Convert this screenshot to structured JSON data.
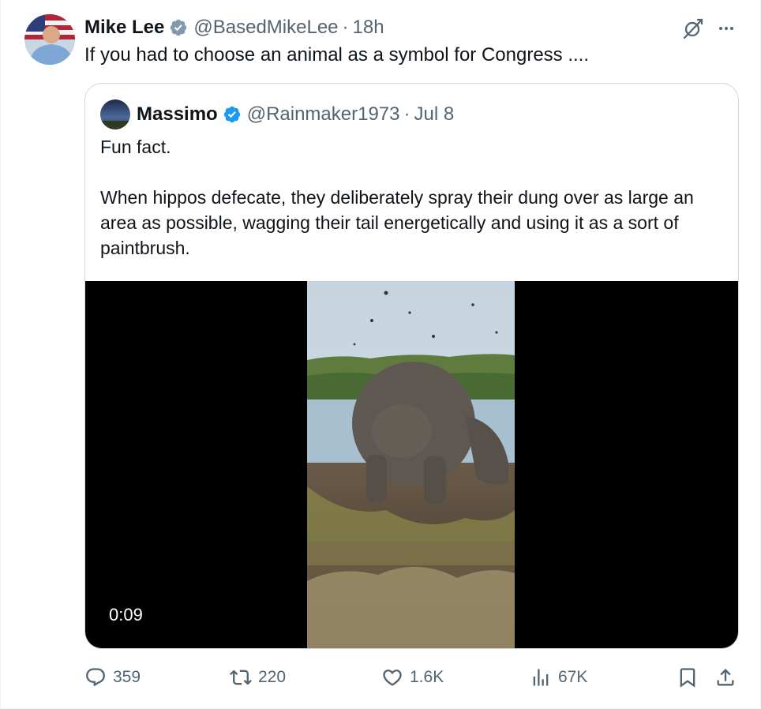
{
  "post": {
    "author": {
      "name": "Mike Lee",
      "handle": "@BasedMikeLee",
      "time": "18h"
    },
    "text": "If you had to choose an animal as a symbol for Congress ...."
  },
  "quote": {
    "author": {
      "name": "Massimo",
      "handle": "@Rainmaker1973",
      "time": "Jul 8"
    },
    "paragraphs": [
      "Fun fact.",
      "When hippos defecate, they deliberately spray their dung over as large an area as possible, wagging their tail energetically and using it as a sort of paintbrush."
    ],
    "video": {
      "timestamp": "0:09"
    }
  },
  "separator": "·",
  "actions": {
    "replies": "359",
    "reposts": "220",
    "likes": "1.6K",
    "views": "67K"
  },
  "icons": {
    "verified": "verified-badge-icon",
    "grok": "grok-icon",
    "more": "more-icon",
    "reply": "reply-icon",
    "repost": "repost-icon",
    "like": "heart-icon",
    "views": "views-chart-icon",
    "bookmark": "bookmark-icon",
    "share": "share-icon"
  },
  "colors": {
    "text": "#0f1419",
    "secondary": "#536471",
    "verified": "#1d9bf0",
    "border": "#cfd9de"
  }
}
